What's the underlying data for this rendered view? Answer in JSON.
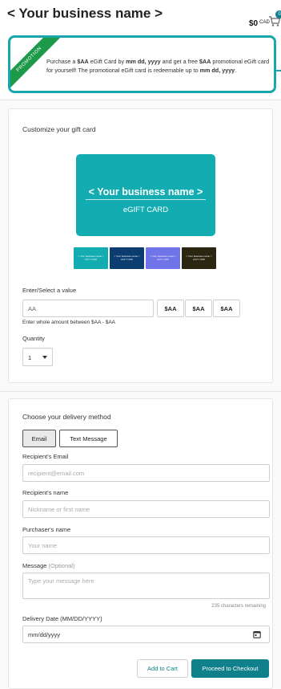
{
  "header": {
    "business_name": "< Your business name >",
    "cart_total": "$0",
    "currency": "CAD",
    "cart_count": "0"
  },
  "promo": {
    "ribbon": "PROMOTION",
    "t1": "Purchase a ",
    "amount1": "$AA",
    "t2": " eGift Card by ",
    "date1": "mm dd, yyyy",
    "t3": " and get a free ",
    "amount2": "$AA",
    "t4": " promotional eGift card for yourself! The promotional eGift card is redeemable up to ",
    "date2": "mm dd, yyyy",
    "t5": "."
  },
  "customize": {
    "title": "Customize your gift card",
    "card_name": "< Your business name >",
    "card_type": "eGIFT CARD",
    "thumbnails": [
      {
        "name": "< Your business name >",
        "sub": "eGIFT CARD",
        "color": "#13adb1"
      },
      {
        "name": "< Your business name >",
        "sub": "eGIFT CARD",
        "color": "#0c3d70"
      },
      {
        "name": "< Your business name >",
        "sub": "eGIFT CARD",
        "color": "#6f74e8"
      },
      {
        "name": "< Your business name >",
        "sub": "eGIFT CARD",
        "color": "#2a2612"
      }
    ],
    "value_label": "Enter/Select a value",
    "value_input": "AA",
    "value_options": [
      "$AA",
      "$AA",
      "$AA"
    ],
    "value_hint": "Enter whole amount between $AA - $AA",
    "quantity_label": "Quantity",
    "quantity_value": "1"
  },
  "delivery": {
    "title": "Choose your delivery method",
    "methods": [
      "Email",
      "Text Message"
    ],
    "active_method": "Email",
    "recipient_email_label": "Recipient's Email",
    "recipient_email_placeholder": "recipient@email.com",
    "recipient_name_label": "Recipient's name",
    "recipient_name_placeholder": "Nickname or first name",
    "purchaser_name_label": "Purchaser's name",
    "purchaser_name_placeholder": "Your name",
    "message_label": "Message",
    "message_optional": "(Optional)",
    "message_placeholder": "Type your message here",
    "chars_remaining": "235 characters remaining",
    "date_label": "Delivery Date (MM/DD/YYYY)",
    "date_value": "mm/dd/yyyy",
    "add_to_cart": "Add to Cart",
    "checkout": "Proceed to Checkout"
  },
  "colors": {
    "accent": "#10808a",
    "card": "#13adb1",
    "promo_border": "#17a7ad",
    "ribbon": "#1c9a4a"
  }
}
